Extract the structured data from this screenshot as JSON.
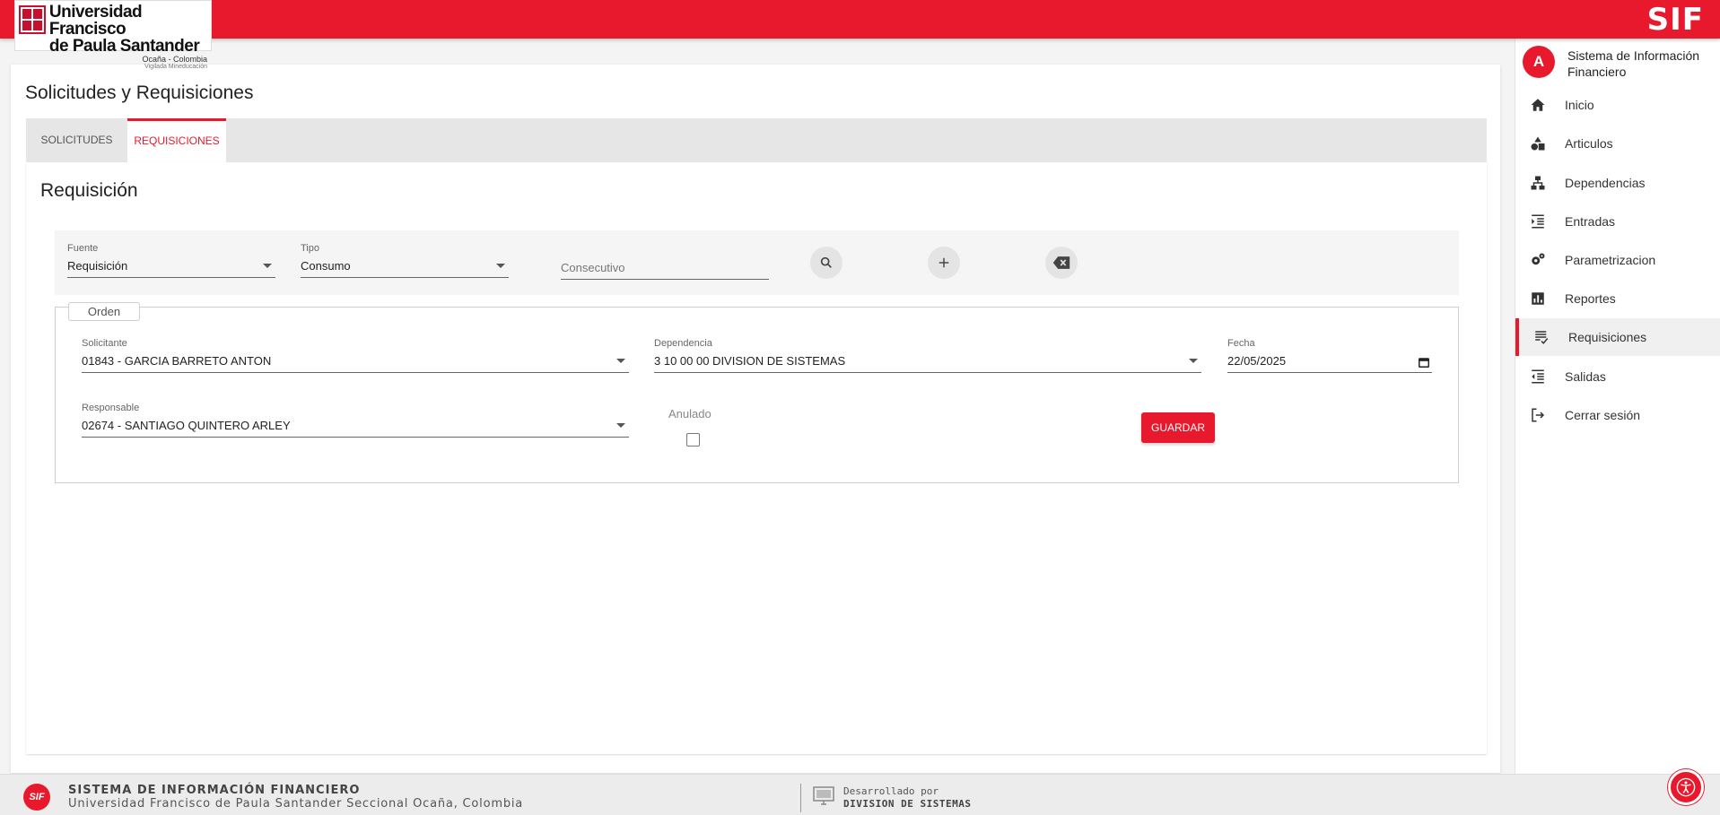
{
  "header": {
    "logo": {
      "line1": "Universidad Francisco",
      "line2": "de Paula Santander",
      "line3": "Ocaña - Colombia",
      "line4": "Vigilada Mineducación"
    },
    "brand": "SIF",
    "accent_color": "#e8192c"
  },
  "page": {
    "title": "Solicitudes y Requisiciones",
    "tabs": [
      {
        "label": "SOLICITUDES",
        "active": false
      },
      {
        "label": "REQUISICIONES",
        "active": true
      }
    ],
    "section_title": "Requisición"
  },
  "filters": {
    "fuente": {
      "label": "Fuente",
      "value": "Requisición"
    },
    "tipo": {
      "label": "Tipo",
      "value": "Consumo"
    },
    "consecutivo": {
      "placeholder": "Consecutivo"
    },
    "search_icon": "search-icon",
    "add_icon": "plus-icon",
    "clear_icon": "backspace-icon"
  },
  "orden": {
    "legend": "Orden",
    "solicitante": {
      "label": "Solicitante",
      "value": "01843 - GARCIA BARRETO ANTON"
    },
    "dependencia": {
      "label": "Dependencia",
      "value": "3 10 00 00 DIVISION DE SISTEMAS"
    },
    "fecha": {
      "label": "Fecha",
      "value": "22/05/2025"
    },
    "responsable": {
      "label": "Responsable",
      "value": "02674 - SANTIAGO QUINTERO ARLEY"
    },
    "anulado": {
      "label": "Anulado",
      "checked": false
    },
    "save_label": "GUARDAR"
  },
  "sidebar": {
    "avatar_letter": "A",
    "title": "Sistema de Información Financiero",
    "items": [
      {
        "label": "Inicio",
        "icon": "home-icon"
      },
      {
        "label": "Articulos",
        "icon": "shapes-icon"
      },
      {
        "label": "Dependencias",
        "icon": "hierarchy-icon"
      },
      {
        "label": "Entradas",
        "icon": "indent-icon"
      },
      {
        "label": "Parametrizacion",
        "icon": "settings-icon"
      },
      {
        "label": "Reportes",
        "icon": "bar-chart-icon"
      },
      {
        "label": "Requisiciones",
        "icon": "list-check-icon",
        "active": true
      },
      {
        "label": "Salidas",
        "icon": "outdent-icon"
      },
      {
        "label": "Cerrar sesión",
        "icon": "logout-icon"
      }
    ]
  },
  "footer": {
    "logo_text": "SIF",
    "line1": "SISTEMA DE INFORMACIÓN FINANCIERO",
    "line2": "Universidad Francisco de Paula Santander Seccional Ocaña, Colombia",
    "dev_line1": "Desarrollado por",
    "dev_line2": "DIVISION DE SISTEMAS"
  }
}
